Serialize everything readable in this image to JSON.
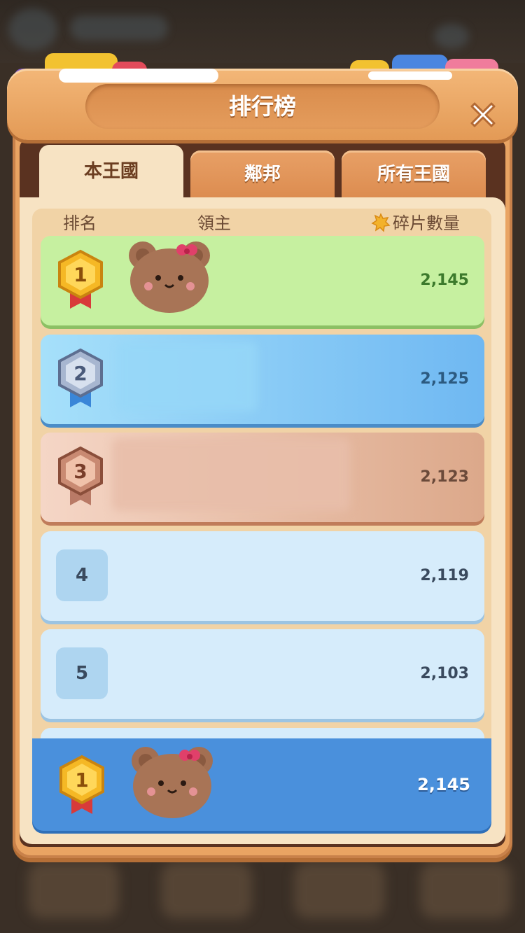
{
  "title": "排行榜",
  "tabs": [
    {
      "label": "本王國",
      "active": true
    },
    {
      "label": "鄰邦",
      "active": false
    },
    {
      "label": "所有王國",
      "active": false
    }
  ],
  "columns": {
    "rank": "排名",
    "lord": "領主",
    "fragments": "碎片數量"
  },
  "rows": [
    {
      "rank": "1",
      "medal": "gold",
      "value": "2,145",
      "color": "#c6f0a0",
      "text_color": "#3c7a2c"
    },
    {
      "rank": "2",
      "medal": "silver",
      "value": "2,125",
      "color": "#8fd3f4",
      "text_color": "#2c5a80"
    },
    {
      "rank": "3",
      "medal": "bronze",
      "value": "2,123",
      "color": "#e8b9a0",
      "text_color": "#6b4a3a"
    },
    {
      "rank": "4",
      "medal": "none",
      "value": "2,119",
      "color": "#d6ecfb",
      "text_color": "#3a4a5e"
    },
    {
      "rank": "5",
      "medal": "none",
      "value": "2,103",
      "color": "#d6ecfb",
      "text_color": "#3a4a5e"
    }
  ],
  "self_row": {
    "rank": "1",
    "medal": "gold",
    "value": "2,145",
    "color": "#4a90dc"
  },
  "icons": {
    "close": "close-icon",
    "fragment": "puzzle-fragment-icon",
    "avatar": "bear-avatar-icon"
  }
}
